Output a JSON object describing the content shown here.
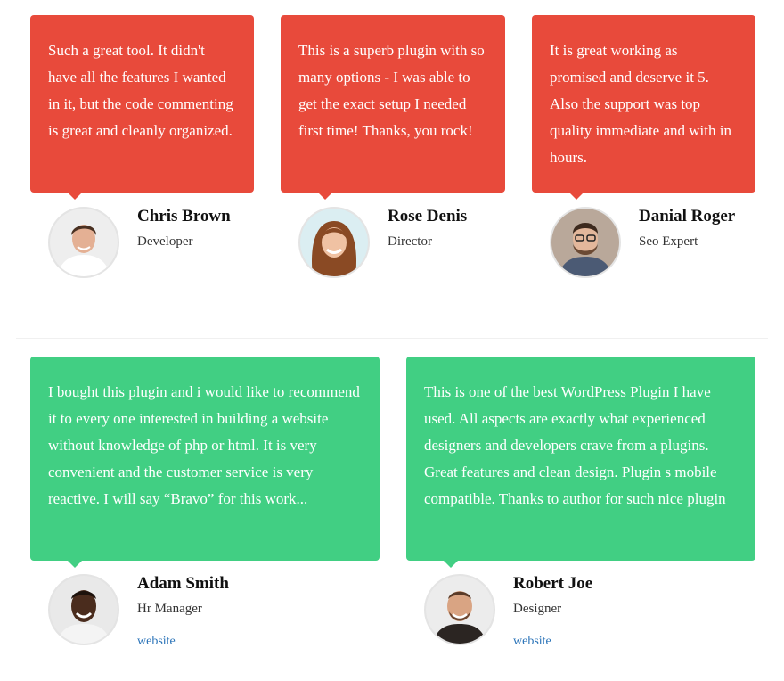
{
  "row1": [
    {
      "quote": "Such a great tool. It didn't have all the features I wanted in it, but the code commenting is great and cleanly organized.",
      "name": "Chris Brown",
      "role": "Developer"
    },
    {
      "quote": "This is a superb plugin with so many options - I was able to get the exact setup I needed first time! Thanks, you rock!",
      "name": "Rose Denis",
      "role": "Director"
    },
    {
      "quote": "It is great working as promised and deserve it 5. Also the support was top quality immediate and with in hours.",
      "name": "Danial Roger",
      "role": "Seo Expert"
    }
  ],
  "row2": [
    {
      "quote": "I bought this plugin and i would like to recommend it to every one interested in building a website without knowledge of php or html. It is very convenient and the customer service is very reactive. I will say “Bravo” for this work...",
      "name": "Adam Smith",
      "role": "Hr Manager",
      "link": "website"
    },
    {
      "quote": "This is one of the best WordPress Plugin I have used. All aspects are exactly what experienced designers and developers crave from a plugins. Great features and clean design. Plugin s mobile compatible. Thanks to author for such nice plugin",
      "name": "Robert Joe",
      "role": "Designer",
      "link": "website"
    }
  ],
  "colors": {
    "row1_bubble": "#e84a3b",
    "row2_bubble": "#41cf83",
    "link": "#2a73b8"
  }
}
